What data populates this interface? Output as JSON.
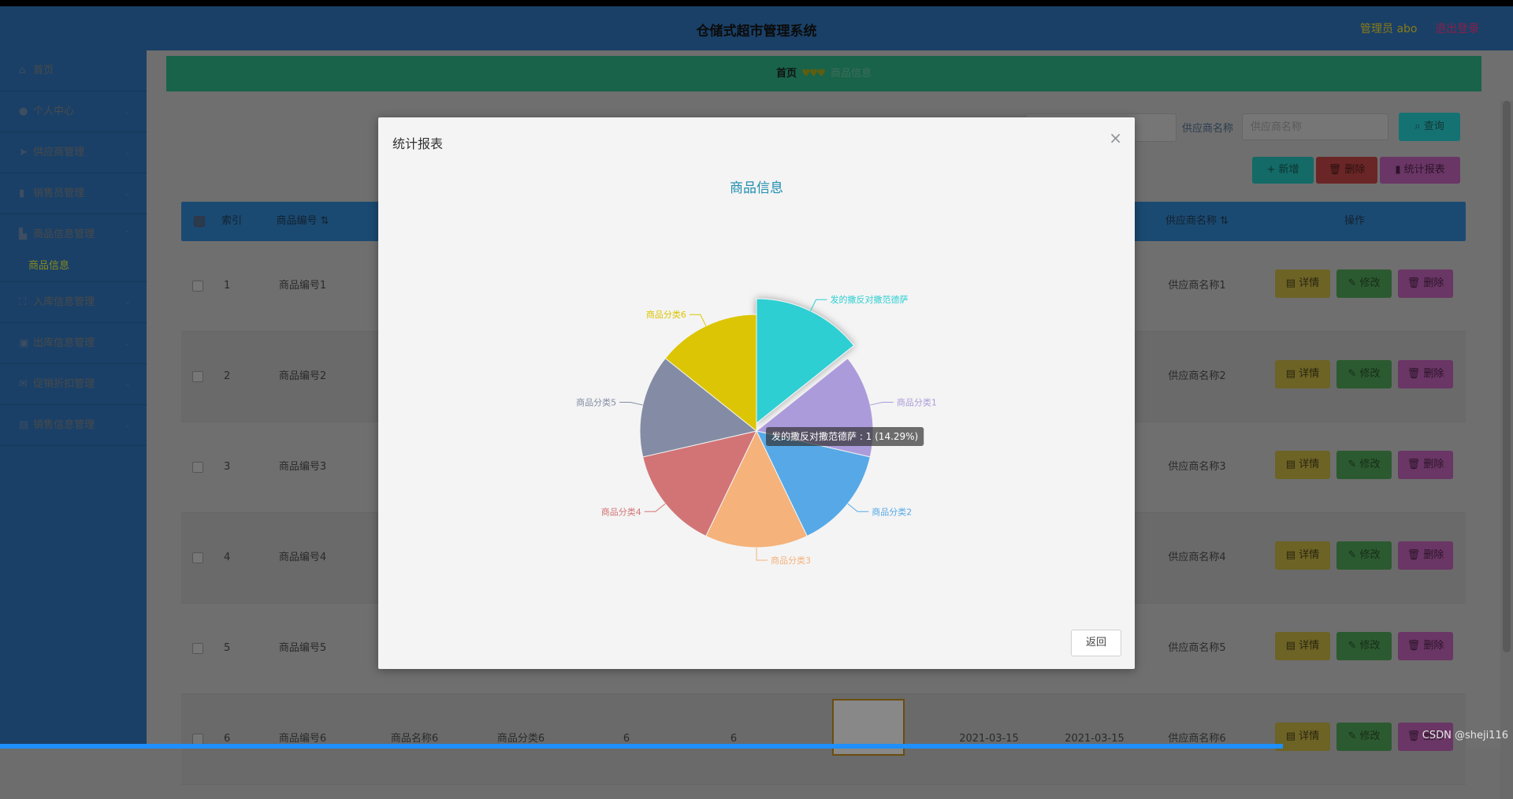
{
  "header": {
    "title": "仓储式超市管理系统",
    "admin": "管理员 abo",
    "logout": "退出登录"
  },
  "sidebar": {
    "items": [
      {
        "label": "首页",
        "icon": "home-icon"
      },
      {
        "label": "个人中心",
        "icon": "user-icon"
      },
      {
        "label": "供应商管理",
        "icon": "send-icon"
      },
      {
        "label": "销售员管理",
        "icon": "bar-chart-icon"
      },
      {
        "label": "商品信息管理",
        "icon": "goods-icon"
      },
      {
        "label": "入库信息管理",
        "icon": "scan-icon"
      },
      {
        "label": "出库信息管理",
        "icon": "box-icon"
      },
      {
        "label": "促销折扣管理",
        "icon": "message-icon"
      },
      {
        "label": "销售信息管理",
        "icon": "bag-icon"
      }
    ],
    "sub_item": "商品信息"
  },
  "breadcrumb": {
    "home": "首页",
    "current": "商品信息",
    "separator": "♥♥♥"
  },
  "search": {
    "label": "供应商名称",
    "placeholder": "供应商名称",
    "query_label": "查询"
  },
  "actions": {
    "add": "新增",
    "delete": "删除",
    "report": "统计报表"
  },
  "table": {
    "headers": {
      "index": "索引",
      "code": "商品编号",
      "supplier": "供应商名称",
      "ops": "操作"
    },
    "rows": [
      {
        "index": "1",
        "code": "商品编号1",
        "supplier": "供应商名称1"
      },
      {
        "index": "2",
        "code": "商品编号2",
        "supplier": "供应商名称2"
      },
      {
        "index": "3",
        "code": "商品编号3",
        "supplier": "供应商名称3"
      },
      {
        "index": "4",
        "code": "商品编号4",
        "supplier": "供应商名称4"
      },
      {
        "index": "5",
        "code": "商品编号5",
        "supplier": "供应商名称5"
      },
      {
        "index": "6",
        "code": "商品编号6",
        "name": "商品名称6",
        "category": "商品分类6",
        "n1": "6",
        "n2": "6",
        "date1": "2021-03-15",
        "date2": "2021-03-15",
        "supplier": "供应商名称6"
      }
    ],
    "op_labels": {
      "detail": "详情",
      "edit": "修改",
      "delete": "删除"
    }
  },
  "dialog": {
    "title": "统计报表",
    "back": "返回",
    "tooltip": "发的撒反对撒范德萨 : 1 (14.29%)"
  },
  "watermark": "CSDN @sheji116",
  "chart_data": {
    "type": "pie",
    "title": "商品信息",
    "highlighted": "发的撒反对撒范德萨",
    "slices": [
      {
        "label": "发的撒反对撒范德萨",
        "value": 1,
        "color": "#2ecfd3"
      },
      {
        "label": "商品分类1",
        "value": 1,
        "color": "#ac9bdb"
      },
      {
        "label": "商品分类2",
        "value": 1,
        "color": "#56a9e6"
      },
      {
        "label": "商品分类3",
        "value": 1,
        "color": "#f5b27a"
      },
      {
        "label": "商品分类4",
        "value": 1,
        "color": "#d27476"
      },
      {
        "label": "商品分类5",
        "value": 1,
        "color": "#838ca4"
      },
      {
        "label": "商品分类6",
        "value": 1,
        "color": "#dcc504"
      }
    ]
  }
}
